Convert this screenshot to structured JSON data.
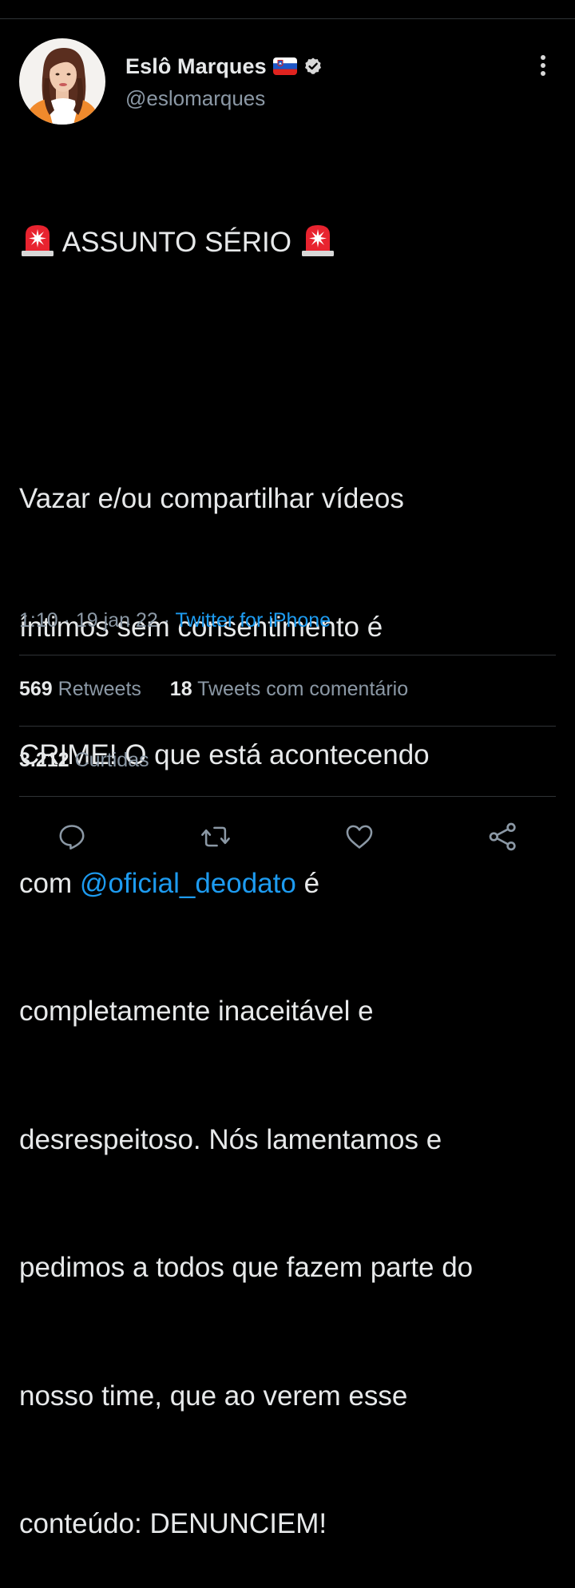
{
  "author": {
    "display_name": "Eslô Marques",
    "handle": "@eslomarques",
    "flag_icon": "slovenia-flag-icon",
    "verified_icon": "verified-badge-icon"
  },
  "tweet": {
    "headline": "ASSUNTO SÉRIO",
    "headline_icon": "rotating-light-emoji",
    "lines": {
      "l1": "Vazar e/ou compartilhar vídeos",
      "l2": "íntimos sem consentimento é",
      "l3": "CRIME! O que está acontecendo",
      "l4_prefix": "com ",
      "mention": "@oficial_deodato",
      "l4_suffix": " é",
      "l5": "completamente inaceitável e",
      "l6": "desrespeitoso. Nós lamentamos e",
      "l7": "pedimos a todos que fazem parte do",
      "l8": "nosso time, que ao verem esse",
      "l9": "conteúdo: DENUNCIEM!"
    },
    "time": "1:10",
    "date": "19 jan 22",
    "separator": " · ",
    "source": "Twitter for iPhone"
  },
  "stats": {
    "retweets_count": "569",
    "retweets_label": "Retweets",
    "quotes_count": "18",
    "quotes_label": "Tweets com comentário",
    "likes_count": "3.212",
    "likes_label": "Curtidas"
  },
  "actions": [
    "reply-icon",
    "retweet-icon",
    "like-icon",
    "share-icon"
  ],
  "colors": {
    "background": "#000000",
    "text": "#E7E9EA",
    "secondary": "#8B98A5",
    "accent": "#1D9BF0",
    "divider": "#2F3336"
  }
}
